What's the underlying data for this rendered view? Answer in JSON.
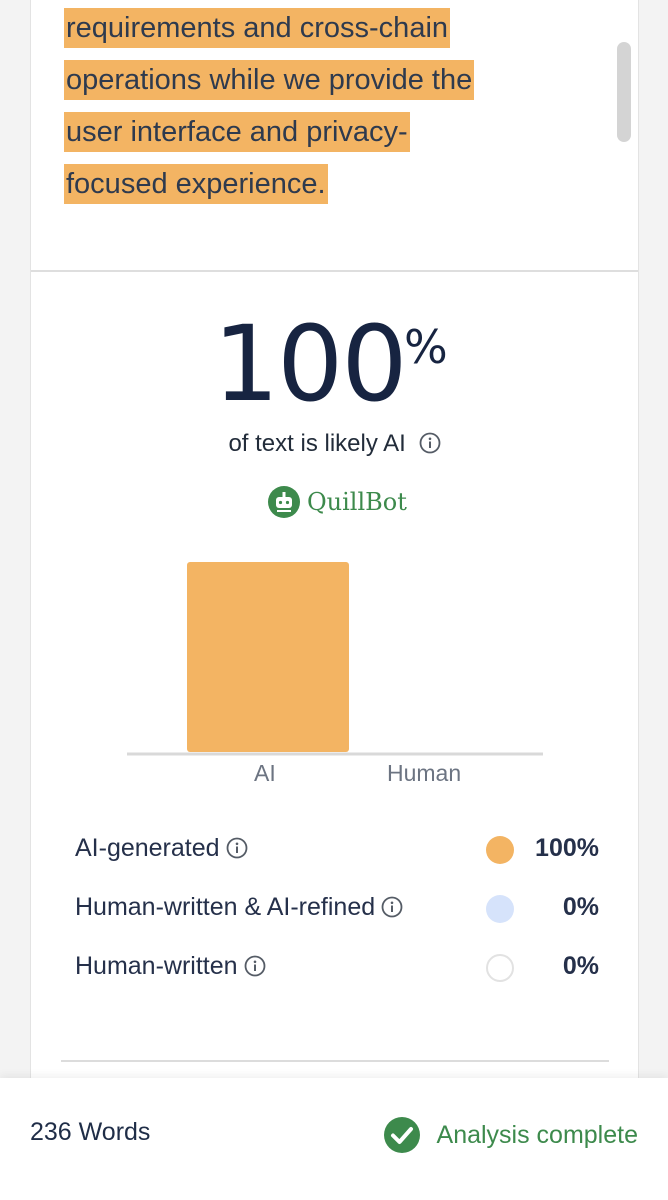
{
  "text_excerpt": {
    "lines": [
      "requirements and cross-chain",
      "operations while we provide the",
      "user interface and privacy-",
      "focused experience."
    ]
  },
  "score": {
    "value": "100",
    "suffix": "%",
    "caption": "of text is likely AI",
    "info_icon": "info-icon"
  },
  "brand": {
    "name": "QuillBot",
    "icon": "quillbot-logo-icon",
    "color": "#3d8a4c"
  },
  "chart_data": {
    "type": "bar",
    "categories": [
      "AI",
      "Human"
    ],
    "values": [
      100,
      0
    ],
    "ylim": [
      0,
      100
    ],
    "bar_color": "#f3b463",
    "title": "",
    "xlabel": "",
    "ylabel": ""
  },
  "legend": [
    {
      "label": "AI-generated",
      "value": "100%",
      "color": "#f3b463",
      "info_icon": "info-icon"
    },
    {
      "label": "Human-written & AI-refined",
      "value": "0%",
      "color": "#d6e3fb",
      "info_icon": "info-icon"
    },
    {
      "label": "Human-written",
      "value": "0%",
      "color": "#ffffff",
      "info_icon": "info-icon"
    }
  ],
  "footer": {
    "word_count": "236 Words",
    "status": "Analysis complete",
    "status_icon": "check-circle-icon",
    "status_color": "#3d8a4c"
  }
}
